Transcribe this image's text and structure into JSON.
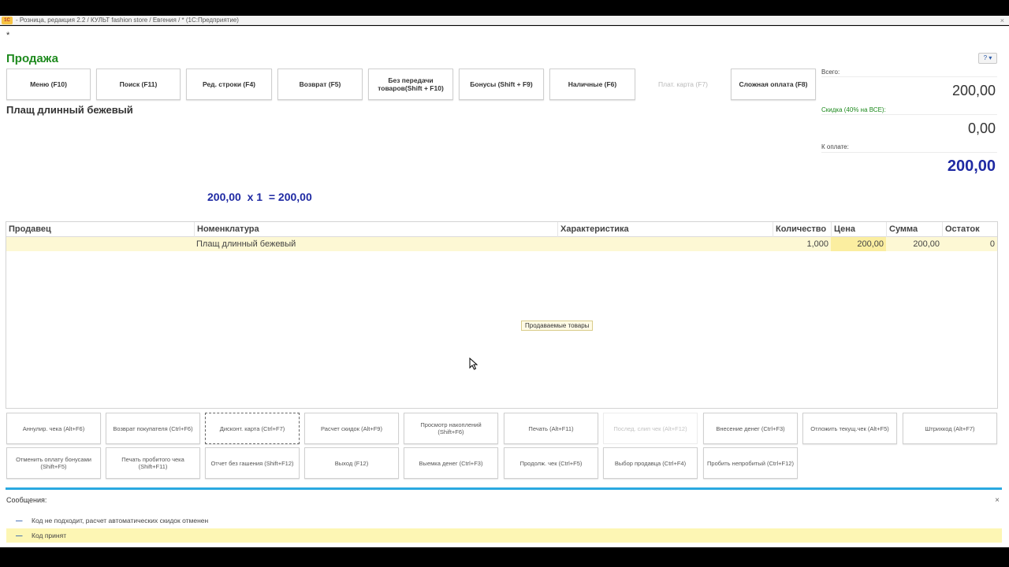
{
  "window": {
    "app_icon": "1С",
    "title": "- Розница, редакция 2.2 / КУЛЬТ fashion store / Евгения / *  (1С:Предприятие)",
    "close": "×"
  },
  "page": {
    "asterisk": "*",
    "title": "Продажа",
    "help": "?"
  },
  "function_buttons": [
    {
      "label": "Меню (F10)",
      "enabled": true
    },
    {
      "label": "Поиск (F11)",
      "enabled": true
    },
    {
      "label": "Ред. строки (F4)",
      "enabled": true
    },
    {
      "label": "Возврат (F5)",
      "enabled": true
    },
    {
      "label": "Без передачи товаров(Shift + F10)",
      "enabled": true
    },
    {
      "label": "Бонусы (Shift + F9)",
      "enabled": true
    },
    {
      "label": "Наличные (F6)",
      "enabled": true
    },
    {
      "label": "Плат. карта (F7)",
      "enabled": false
    },
    {
      "label": "Сложная оплата (F8)",
      "enabled": true
    }
  ],
  "current_item": {
    "name": "Плащ длинный бежевый",
    "calc": "200,00  x 1  = 200,00"
  },
  "summary": {
    "total_label": "Всего:",
    "total_value": "200,00",
    "discount_label": "Скидка (40% на ВСЕ):",
    "discount_value": "0,00",
    "pay_label": "К оплате:",
    "pay_value": "200,00"
  },
  "table": {
    "columns": [
      "Продавец",
      "Номенклатура",
      "Характеристика",
      "Количество",
      "Цена",
      "Сумма",
      "Остаток"
    ],
    "rows": [
      {
        "seller": "",
        "item": "Плащ длинный бежевый",
        "characteristic": "",
        "qty": "1,000",
        "price": "200,00",
        "sum": "200,00",
        "stock": "0"
      }
    ],
    "tooltip": "Продаваемые товары"
  },
  "action_buttons": [
    {
      "label": "Аннулир. чека (Alt+F6)",
      "state": "normal"
    },
    {
      "label": "Возврат покупателя (Ctrl+F6)",
      "state": "normal"
    },
    {
      "label": "Дисконт. карта (Ctrl+F7)",
      "state": "focused"
    },
    {
      "label": "Расчет скидок (Alt+F9)",
      "state": "normal"
    },
    {
      "label": "Просмотр накоплений (Shift+F6)",
      "state": "normal"
    },
    {
      "label": "Печать (Alt+F11)",
      "state": "normal"
    },
    {
      "label": "Послед. слип чек (Alt+F12)",
      "state": "disabled"
    },
    {
      "label": "Внесение денег (Ctrl+F3)",
      "state": "normal"
    },
    {
      "label": "Отложить текущ.чек (Alt+F5)",
      "state": "normal"
    },
    {
      "label": "Штрихкод (Alt+F7)",
      "state": "normal"
    },
    {
      "label": "Отменить оплату бонусами (Shift+F5)",
      "state": "normal"
    },
    {
      "label": "Печать пробитого чека (Shift+F11)",
      "state": "normal"
    },
    {
      "label": "Отчет без гашения (Shift+F12)",
      "state": "normal"
    },
    {
      "label": "Выход (F12)",
      "state": "normal"
    },
    {
      "label": "Выемка денег (Ctrl+F3)",
      "state": "normal"
    },
    {
      "label": "Продолж. чек (Ctrl+F5)",
      "state": "normal"
    },
    {
      "label": "Выбор продавца (Ctrl+F4)",
      "state": "normal"
    },
    {
      "label": "Пробить непробитый (Ctrl+F12)",
      "state": "normal"
    }
  ],
  "messages": {
    "title": "Сообщения:",
    "close": "×",
    "items": [
      {
        "text": "Код не подходит, расчет автоматических скидок отменен",
        "highlight": false
      },
      {
        "text": "Код принят",
        "highlight": true
      }
    ]
  },
  "colors": {
    "title_green": "#1e8a1e",
    "amount_blue": "#1f2aa3",
    "row_highlight": "#fdf8d4",
    "message_bar": "#2aa9e0"
  }
}
